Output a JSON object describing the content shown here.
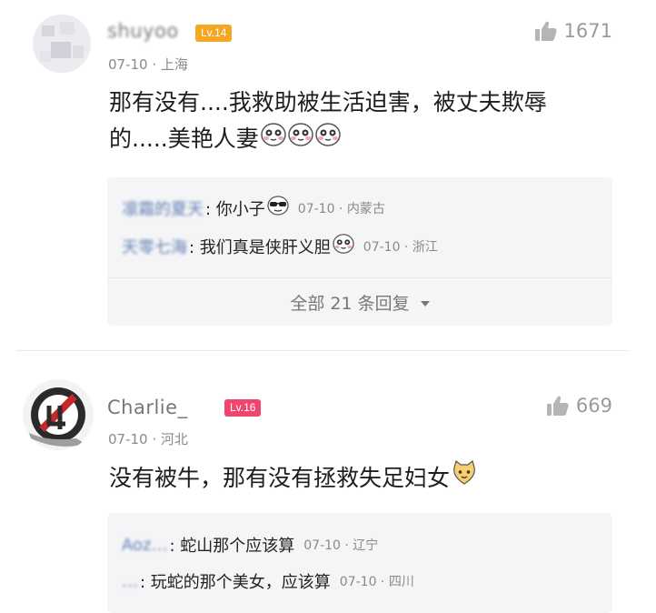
{
  "comments": [
    {
      "username": "shuyoo",
      "level": "Lv.14",
      "level_color": "#f5a623",
      "meta": "07-10 · 上海",
      "likes": "1671",
      "text_line1": "那有没有....我救助被生活迫害，被丈夫欺辱",
      "text_line2": "的.....美艳人妻",
      "emojis": [
        "panda-emoji",
        "panda-emoji",
        "panda-emoji"
      ],
      "replies": [
        {
          "name": "凛霜的夏天",
          "text": ": 你小子",
          "emoji": "sunglasses-emoji",
          "meta": "07-10 · 内蒙古"
        },
        {
          "name": "天零七海",
          "text": ": 我们真是侠肝义胆",
          "emoji": "panda-emoji",
          "meta": "07-10 · 浙江"
        }
      ],
      "more_replies": "全部 21 条回复"
    },
    {
      "username": "Charlie_ ",
      "level": "Lv.16",
      "level_color": "#f0466e",
      "meta": "07-10 · 河北",
      "likes": "669",
      "text": "没有被牛，那有没有拯救失足妇女",
      "emoji": "cat-emoji",
      "replies": [
        {
          "name": "Aoz…",
          "text": ": 蛇山那个应该算",
          "meta": "07-10 · 辽宁"
        },
        {
          "name": "…",
          "text": ": 玩蛇的那个美女，应该算",
          "meta": "07-10 · 四川"
        }
      ]
    }
  ]
}
